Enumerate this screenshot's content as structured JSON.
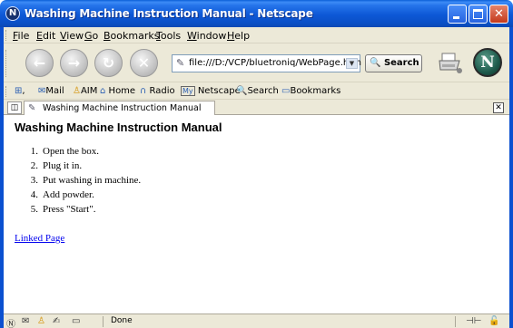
{
  "window": {
    "title": "Washing Machine Instruction Manual - Netscape",
    "app_icon": "netscape-icon"
  },
  "menu": [
    "File",
    "Edit",
    "View",
    "Go",
    "Bookmarks",
    "Tools",
    "Window",
    "Help"
  ],
  "menu_access_keys": [
    "F",
    "E",
    "V",
    "G",
    "B",
    "T",
    "W",
    "H"
  ],
  "navigation": {
    "back": "back-icon",
    "forward": "forward-icon",
    "reload": "reload-icon",
    "stop": "stop-icon",
    "url": "file:///D:/VCP/bluetroniq/WebPage.htm",
    "search_label": "Search"
  },
  "personal_toolbar": [
    "Mail",
    "AIM",
    "Home",
    "Radio",
    "Netscape",
    "Search",
    "Bookmarks"
  ],
  "tab": {
    "label": "Washing Machine Instruction Manual"
  },
  "page": {
    "heading": "Washing Machine Instruction Manual",
    "steps": [
      {
        "num": "1.",
        "text": "Open the box."
      },
      {
        "num": "2.",
        "text": "Plug it in."
      },
      {
        "num": "3.",
        "text": "Put washing in machine."
      },
      {
        "num": "4.",
        "text": "Add powder."
      },
      {
        "num": "5.",
        "text": "Press \"Start\"."
      }
    ],
    "link_text": "Linked Page"
  },
  "status": {
    "text": "Done"
  },
  "colors": {
    "titlebar": "#0a4fc6",
    "link": "#0000ee",
    "chrome": "#ece9d8"
  }
}
